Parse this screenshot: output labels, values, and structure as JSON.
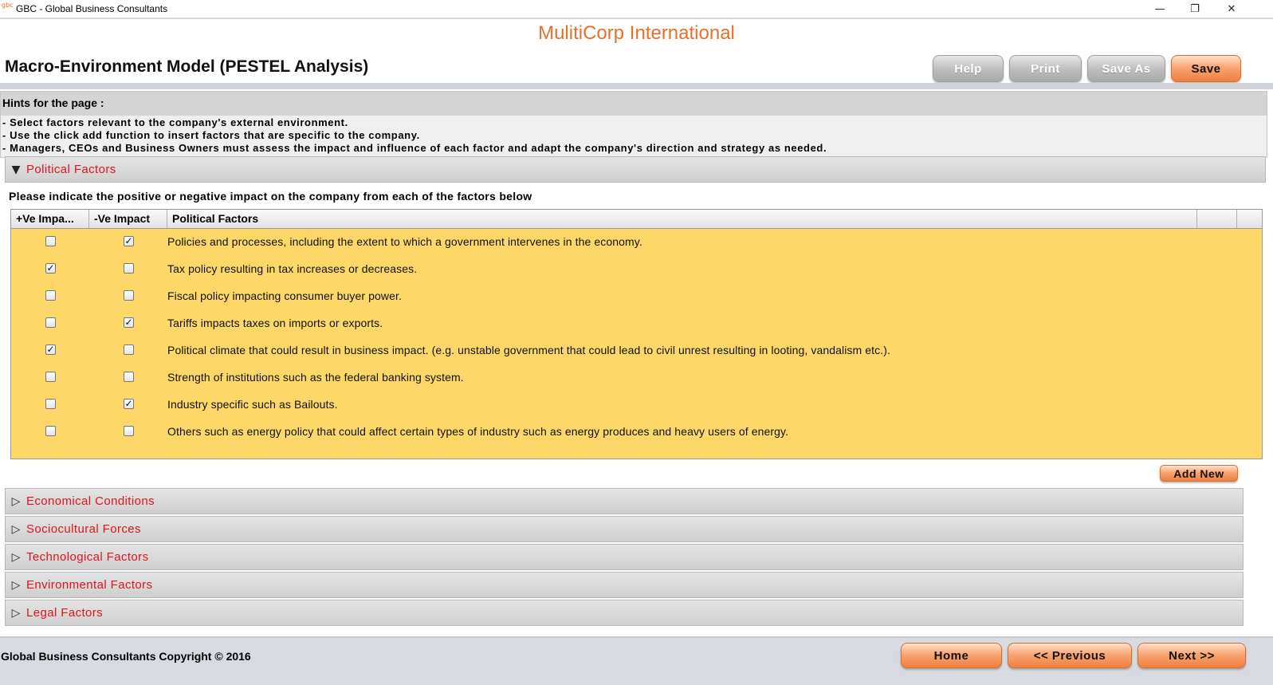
{
  "window": {
    "icon_text": "gbc",
    "title": "GBC - Global Business Consultants",
    "minimize": "—",
    "restore": "❐",
    "close": "✕"
  },
  "header": {
    "company": "MulitiCorp International",
    "page_title": "Macro-Environment Model (PESTEL Analysis)",
    "buttons": {
      "help": "Help",
      "print": "Print",
      "save_as": "Save As",
      "save": "Save"
    }
  },
  "hints": {
    "heading": "Hints for the page :",
    "lines": [
      "- Select factors relevant to the company's external environment.",
      "- Use the click add function to insert factors that are specific to the company.",
      "- Managers, CEOs and Business Owners must assess the impact and influence of each factor and adapt the company's direction and strategy as needed."
    ]
  },
  "sections": [
    {
      "label": "Political Factors",
      "expanded": true,
      "icon": "triangle-down-icon"
    },
    {
      "label": "Economical Conditions",
      "expanded": false,
      "icon": "triangle-right-icon"
    },
    {
      "label": "Sociocultural Forces",
      "expanded": false,
      "icon": "triangle-right-icon"
    },
    {
      "label": "Technological Factors",
      "expanded": false,
      "icon": "triangle-right-icon"
    },
    {
      "label": "Environmental Factors",
      "expanded": false,
      "icon": "triangle-right-icon"
    },
    {
      "label": "Legal Factors",
      "expanded": false,
      "icon": "triangle-right-icon"
    }
  ],
  "political": {
    "instruction": "Please indicate the positive or negative impact on the company from each of the factors below",
    "columns": [
      "+Ve Impa...",
      "-Ve Impact",
      "Political Factors"
    ],
    "rows": [
      {
        "positive": false,
        "negative": true,
        "factor": "Policies and processes, including the extent to which a government intervenes in the economy."
      },
      {
        "positive": true,
        "negative": false,
        "factor": "Tax policy resulting in tax increases or decreases."
      },
      {
        "positive": false,
        "negative": false,
        "factor": "Fiscal policy impacting consumer buyer power."
      },
      {
        "positive": false,
        "negative": true,
        "factor": "Tariffs impacts taxes on imports or exports."
      },
      {
        "positive": true,
        "negative": false,
        "factor": "Political climate that could result in business impact. (e.g. unstable government that could lead to civil unrest resulting in looting, vandalism etc.)."
      },
      {
        "positive": false,
        "negative": false,
        "factor": "Strength of institutions such as the federal banking system."
      },
      {
        "positive": false,
        "negative": true,
        "factor": "Industry specific such as Bailouts."
      },
      {
        "positive": false,
        "negative": false,
        "factor": "Others such as energy policy that could affect certain types of industry such as energy produces and heavy users of energy."
      }
    ],
    "add_new": "Add New",
    "row_color": "#fdd768"
  },
  "footer": {
    "copyright": "Global Business Consultants Copyright © 2016",
    "home": "Home",
    "previous": "<< Previous",
    "next": "Next >>"
  },
  "colors": {
    "accent": "#e8702a",
    "section_label": "#e0141e"
  }
}
